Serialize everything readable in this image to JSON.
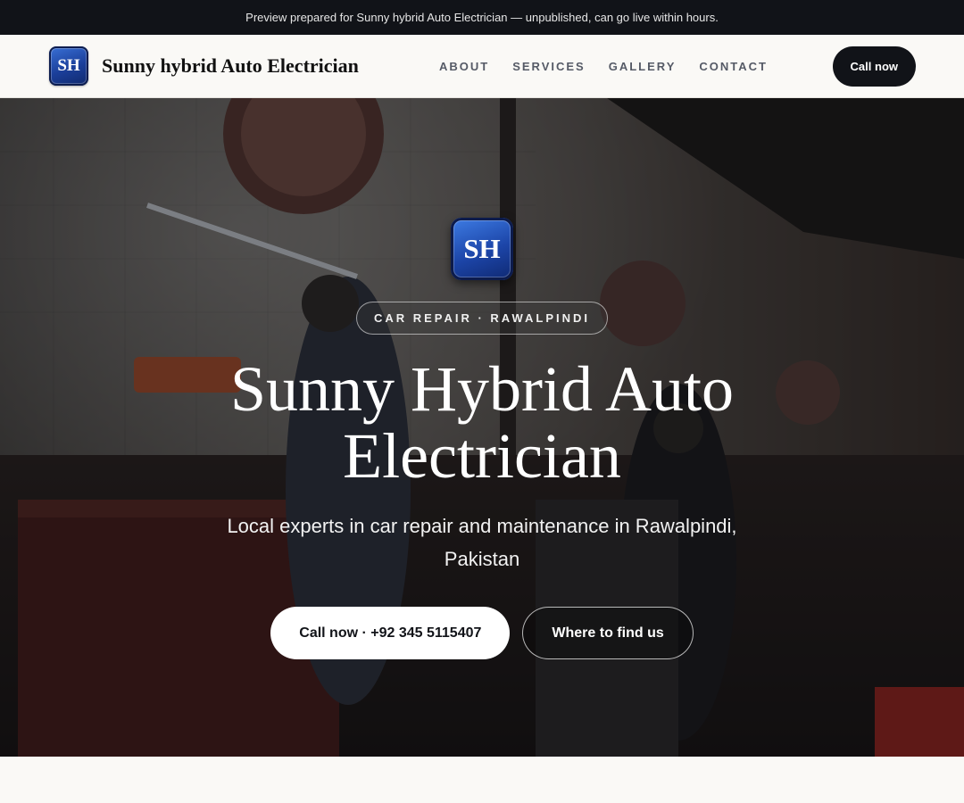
{
  "topbar": {
    "text": "Preview prepared for Sunny hybrid Auto Electrician — unpublished, can go live within hours."
  },
  "brand": {
    "logo_text": "SH",
    "name": "Sunny hybrid Auto Electrician"
  },
  "nav": {
    "links": [
      {
        "label": "ABOUT"
      },
      {
        "label": "SERVICES"
      },
      {
        "label": "GALLERY"
      },
      {
        "label": "CONTACT"
      }
    ],
    "cta_label": "Call now"
  },
  "hero": {
    "logo_text": "SH",
    "tag": "CAR REPAIR · RAWALPINDI",
    "title": "Sunny Hybrid Auto Electrician",
    "subtitle": "Local experts in car repair and maintenance in Rawalpindi, Pakistan",
    "primary_button": "Call now · +92 345 5115407",
    "secondary_button": "Where to find us"
  },
  "colors": {
    "topbar_bg": "#111318",
    "accent_dark": "#111318",
    "logo_blue": "#1b3f9a",
    "page_bg": "#faf9f6"
  }
}
